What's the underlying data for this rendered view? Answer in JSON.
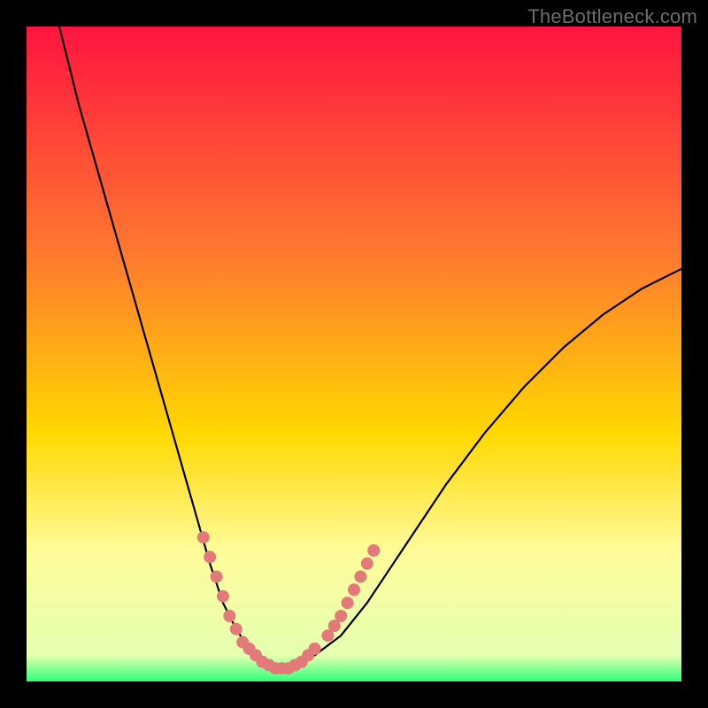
{
  "watermark": "TheBottleneck.com",
  "colors": {
    "top": "#ff1440",
    "upper": "#ff7a2f",
    "mid": "#ffd800",
    "lower": "#fffb9a",
    "floor": "#e5ffb0",
    "bottom": "#2fff7a",
    "curve_stroke": "#000000",
    "marker_fill": "#e27a7a"
  },
  "chart_data": {
    "type": "line",
    "title": "",
    "xlabel": "",
    "ylabel": "",
    "xlim": [
      0,
      100
    ],
    "ylim": [
      0,
      100
    ],
    "series": [
      {
        "name": "bottleneck-curve",
        "x": [
          5,
          8,
          12,
          16,
          20,
          24,
          26,
          28,
          30,
          32,
          34,
          36,
          38,
          40,
          44,
          48,
          52,
          56,
          60,
          64,
          70,
          76,
          82,
          88,
          94,
          100
        ],
        "y": [
          100,
          88,
          74,
          60,
          46,
          32,
          25,
          18,
          12,
          8,
          5,
          3,
          2,
          2,
          4,
          7,
          12,
          18,
          24,
          30,
          38,
          45,
          51,
          56,
          60,
          63
        ]
      }
    ],
    "markers": {
      "name": "highlighted-points",
      "x": [
        27,
        28,
        29,
        30,
        31,
        32,
        33,
        34,
        35,
        36,
        37,
        38,
        39,
        40,
        41,
        42,
        43,
        44,
        46,
        47,
        48,
        49,
        50,
        51,
        52,
        53
      ],
      "y": [
        22,
        19,
        16,
        13,
        10,
        8,
        6,
        5,
        4,
        3,
        2.5,
        2,
        2,
        2,
        2.5,
        3,
        4,
        5,
        7,
        8.5,
        10,
        12,
        14,
        16,
        18,
        20
      ]
    }
  }
}
